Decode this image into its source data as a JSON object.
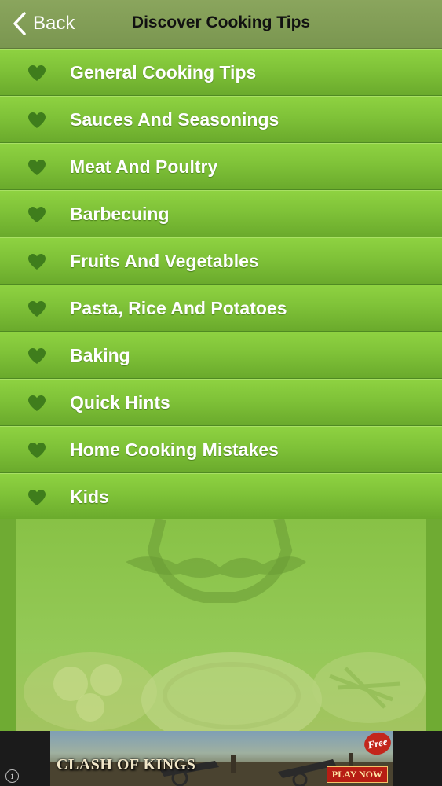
{
  "header": {
    "back_label": "Back",
    "title": "Discover Cooking Tips"
  },
  "menu": {
    "items": [
      {
        "label": "General Cooking Tips",
        "icon": "heart-icon"
      },
      {
        "label": "Sauces And Seasonings",
        "icon": "heart-icon"
      },
      {
        "label": "Meat And Poultry",
        "icon": "heart-icon"
      },
      {
        "label": "Barbecuing",
        "icon": "heart-icon"
      },
      {
        "label": "Fruits And Vegetables",
        "icon": "heart-icon"
      },
      {
        "label": "Pasta, Rice And Potatoes",
        "icon": "heart-icon"
      },
      {
        "label": "Baking",
        "icon": "heart-icon"
      },
      {
        "label": "Quick Hints",
        "icon": "heart-icon"
      },
      {
        "label": "Home Cooking Mistakes",
        "icon": "heart-icon"
      },
      {
        "label": "Kids",
        "icon": "heart-icon"
      }
    ]
  },
  "ad": {
    "logo_text": "CLASH OF KINGS",
    "cta_text": "PLAY NOW",
    "badge_text": "Free",
    "info_icon": "info-icon"
  },
  "colors": {
    "navbar": "#7f9b55",
    "menu_item": "#7fc238",
    "heart": "#3f7d1c"
  }
}
